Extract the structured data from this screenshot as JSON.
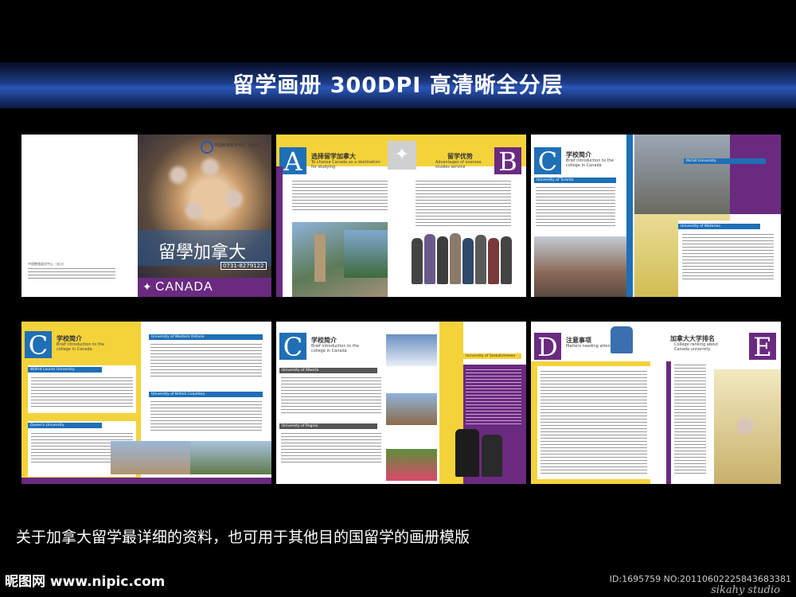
{
  "header": {
    "title": "留学画册  300DPI 高清晰全分层"
  },
  "footer": {
    "caption": "关于加拿大留学最详细的资料，也可用于其他目的国留学的画册模版",
    "logo": "昵图网 www.nipic.com",
    "id_text": "ID:1695759 NO:20110602225843683381",
    "studio": "sikahy studio"
  },
  "p1": {
    "org": "中国教育留学中心（长沙）",
    "title": "留學加拿大",
    "phone": "0731-8279122",
    "country": "CANADA"
  },
  "p2": {
    "letter_a": "A",
    "title_a": "选择留学加拿大",
    "sub_a": "To choose Canada as a destination for studying",
    "letter_b": "B",
    "title_b": "留学优势",
    "sub_b": "Advantages of oversea studies service"
  },
  "p3": {
    "letter": "C",
    "title": "学校简介",
    "sub": "Brief introduction to the college in Canada",
    "uni1": "University of Toronto",
    "uni2": "McGill University",
    "uni3": "University of Waterloo"
  },
  "p4": {
    "letter": "C",
    "title": "学校简介",
    "sub": "Brief introduction to the college in Canada",
    "uni1": "Wilfrid Laurier University",
    "uni2": "Queen's University",
    "uni3": "University of Western Ontario",
    "uni4": "University of British Columbia"
  },
  "p5": {
    "letter": "C",
    "title": "学校简介",
    "sub": "Brief introduction to the college in Canada",
    "uni1": "University of Alberta",
    "uni2": "University of Regina",
    "uni3": "University of Saskatchewan"
  },
  "p6": {
    "letter_d": "D",
    "title_d": "注意事项",
    "sub_d": "Matters needing attention",
    "letter_e": "E",
    "title_e": "加拿大大学排名",
    "sub_e": "College ranking about Canada university"
  },
  "colors": {
    "blue": "#1f6fb7",
    "purple": "#6a2a80",
    "yellow": "#f4d33a",
    "band": "#2a56b8"
  }
}
